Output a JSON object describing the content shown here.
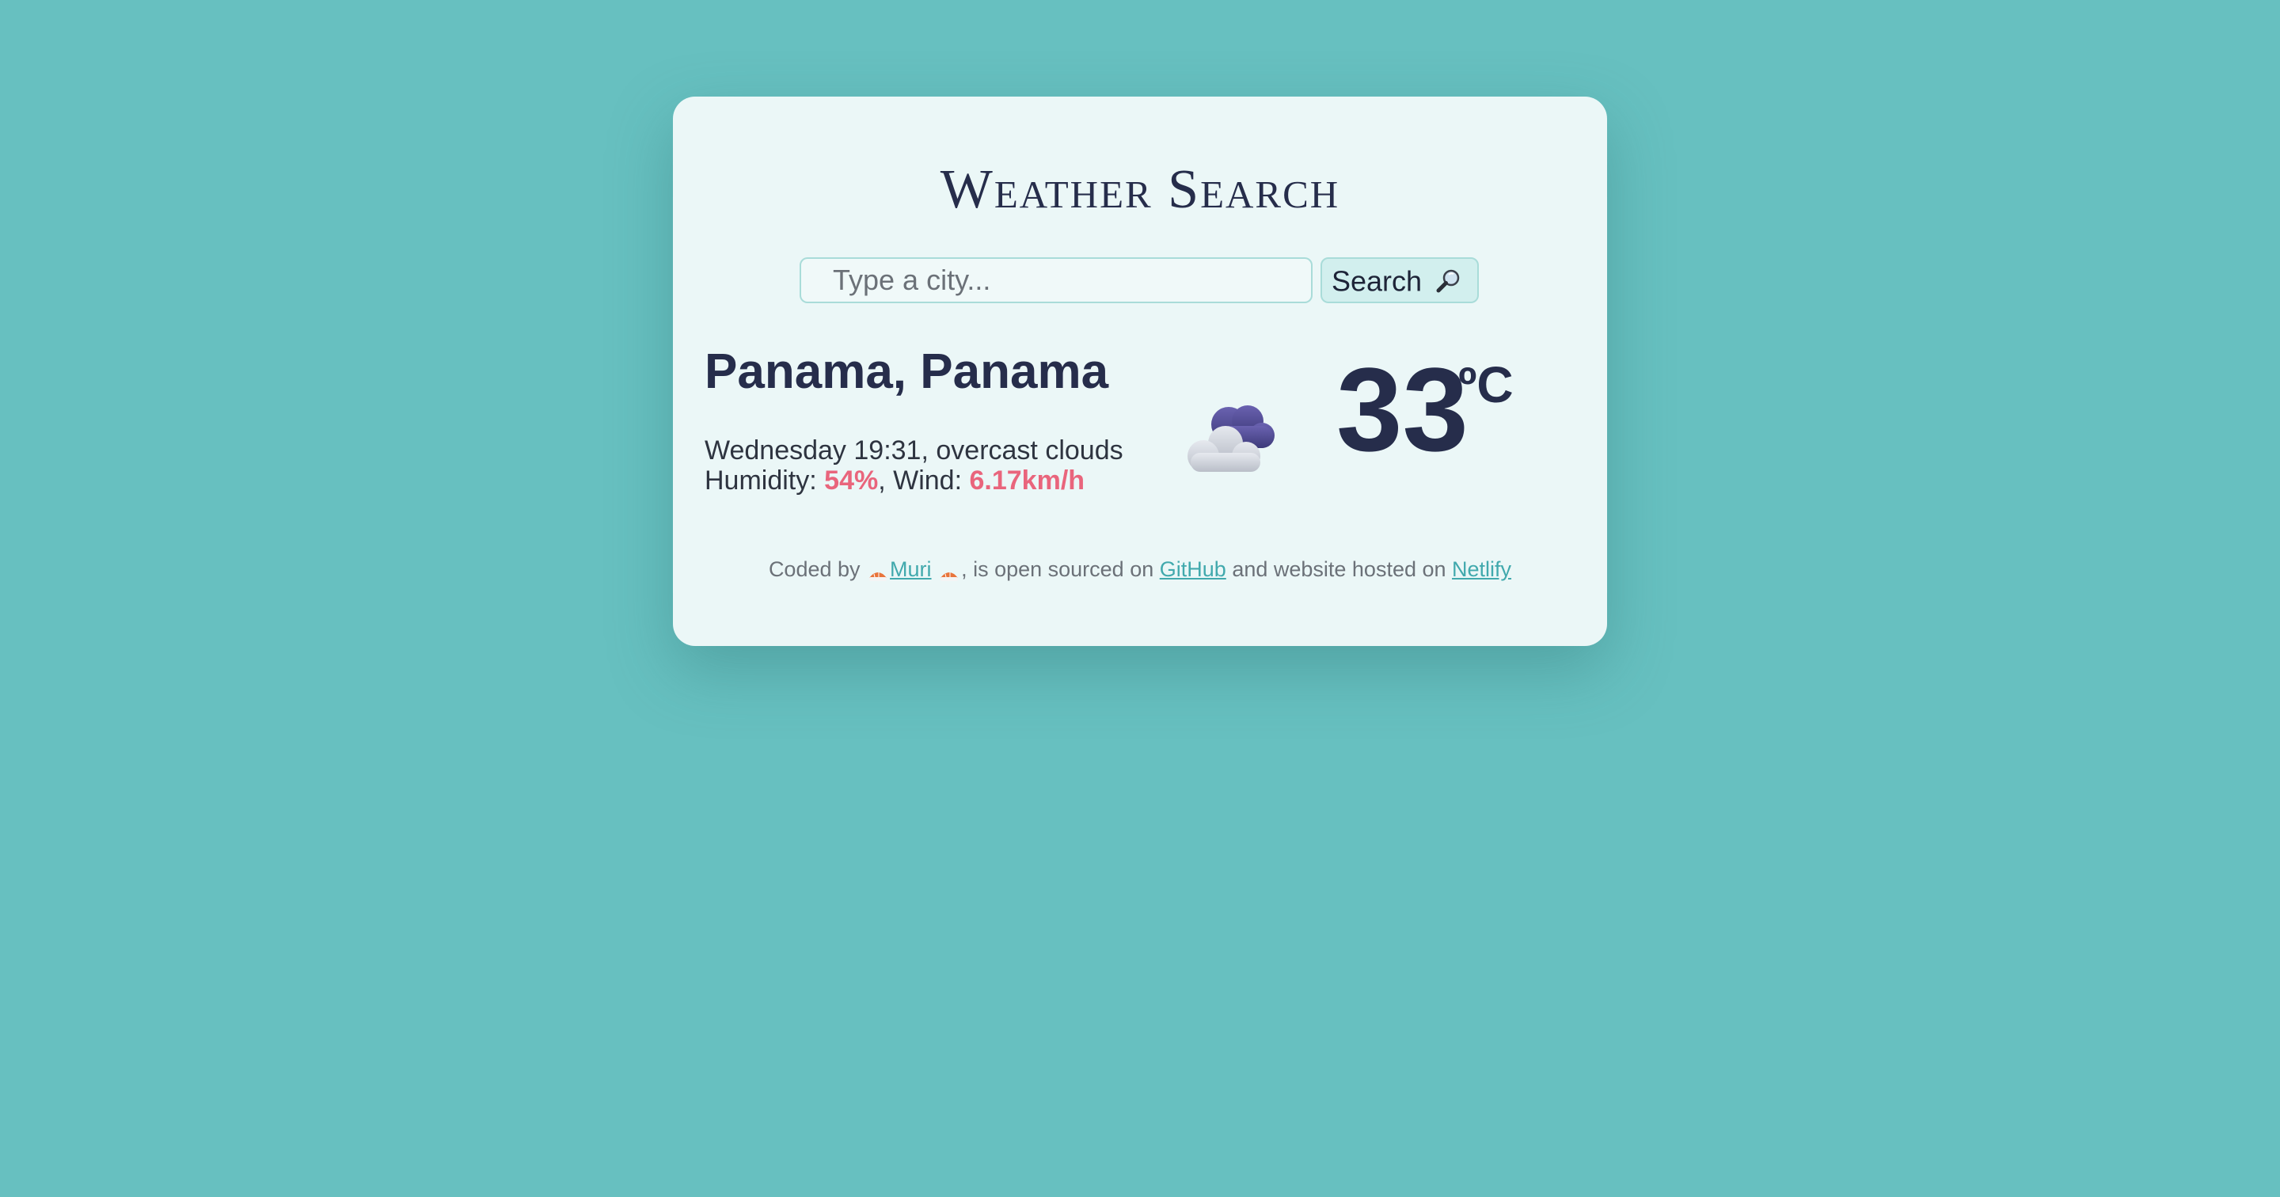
{
  "app": {
    "title": "Weather Search"
  },
  "search": {
    "placeholder": "Type a city...",
    "value": "",
    "button_label": "Search"
  },
  "weather": {
    "location": "Panama, Panama",
    "day_time": "Wednesday 19:31",
    "description": "overcast clouds",
    "humidity_label": "Humidity:",
    "humidity_value": "54%",
    "wind_label": "Wind:",
    "wind_value": "6.17km/h",
    "temperature": "33",
    "unit": "ºC",
    "icon": "overcast-clouds-icon"
  },
  "footer": {
    "coded_by": "Coded by",
    "author": "Muri",
    "open_sourced_on": ", is open sourced on",
    "github_label": "GitHub",
    "hosted_on": "and website hosted on",
    "netlify_label": "Netlify"
  },
  "colors": {
    "background": "#67c0c0",
    "card": "#ebf7f7",
    "heading": "#262d4b",
    "accent": "#e9657c",
    "link": "#41a9ad"
  }
}
